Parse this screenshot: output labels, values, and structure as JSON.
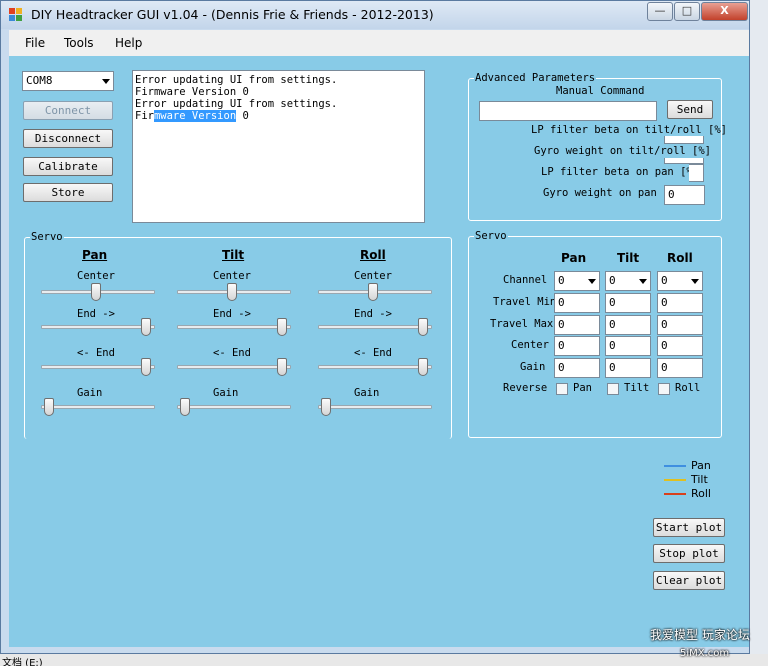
{
  "window": {
    "title": "DIY Headtracker GUI v1.04  - (Dennis Frie & Friends - 2012-2013)",
    "minimize": "—",
    "maximize": "□",
    "close": "X"
  },
  "menu": [
    "File",
    "Tools",
    "Help"
  ],
  "port": {
    "value": "COM8"
  },
  "buttons": {
    "connect": "Connect",
    "disconnect": "Disconnect",
    "calibrate": "Calibrate",
    "store": "Store",
    "send": "Send",
    "start_plot": "Start plot",
    "stop_plot": "Stop plot",
    "clear_plot": "Clear plot"
  },
  "log": {
    "lines": [
      "Error updating UI from settings.",
      "Firmware Version 0",
      "Error updating UI from settings."
    ],
    "last_prefix": "Fir",
    "last_selected": "mware Version",
    "last_suffix": " 0"
  },
  "advanced": {
    "title": "Advanced Parameters",
    "manual_command_label": "Manual Command",
    "manual_command_value": "",
    "lp_tilt_roll_label": "LP filter beta on tilt/roll [%]",
    "lp_tilt_roll_value": "",
    "gyro_tilt_roll_label": "Gyro weight on tilt/roll [%]",
    "gyro_tilt_roll_value": "",
    "lp_pan_label": "LP filter beta on pan [%]",
    "lp_pan_value": "",
    "gyro_pan_label": "Gyro weight on pan [",
    "gyro_pan_value": "0"
  },
  "servo_sliders": {
    "title": "Servo",
    "columns": [
      {
        "name": "Pan",
        "center": 0.48,
        "end_right": 0.96,
        "end_left": 0.96,
        "gain": 0.03
      },
      {
        "name": "Tilt",
        "center": 0.48,
        "end_right": 0.96,
        "end_left": 0.96,
        "gain": 0.03
      },
      {
        "name": "Roll",
        "center": 0.48,
        "end_right": 0.96,
        "end_left": 0.96,
        "gain": 0.03
      }
    ],
    "center_label": "Center",
    "end_right_label": "End ->",
    "end_left_label": "<- End",
    "gain_label": "Gain"
  },
  "servo_table": {
    "title": "Servo",
    "headers": [
      "Pan",
      "Tilt",
      "Roll"
    ],
    "channel_label": "Channel",
    "channel_values": [
      "0",
      "0",
      "0"
    ],
    "rows": [
      {
        "label": "Travel Min",
        "values": [
          "0",
          "0",
          "0"
        ]
      },
      {
        "label": "Travel Max",
        "values": [
          "0",
          "0",
          "0"
        ]
      },
      {
        "label": "Center",
        "values": [
          "0",
          "0",
          "0"
        ]
      },
      {
        "label": "Gain",
        "values": [
          "0",
          "0",
          "0"
        ]
      }
    ],
    "reverse_label": "Reverse",
    "reverse": [
      {
        "label": "Pan",
        "checked": false
      },
      {
        "label": "Tilt",
        "checked": false
      },
      {
        "label": "Roll",
        "checked": false
      }
    ]
  },
  "legend": [
    {
      "label": "Pan",
      "color": "#3f8fe0"
    },
    {
      "label": "Tilt",
      "color": "#e0c020"
    },
    {
      "label": "Roll",
      "color": "#d8401c"
    }
  ],
  "taskbar": {
    "text": "文档 (E:)"
  },
  "watermark": {
    "line1": "我爱模型 玩家论坛",
    "line2": "5iMX.com"
  }
}
